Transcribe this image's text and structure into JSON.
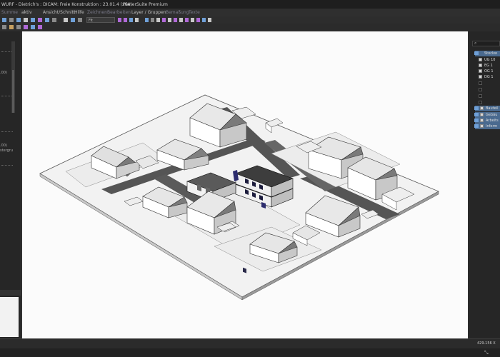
{
  "window": {
    "title": "WURF - Dietrich's : DICAM: Freie Konstruktion : 23.01.4 (x64)",
    "suite": "PlanerSuite Premium"
  },
  "menubar": {
    "items": [
      {
        "label": "Summe"
      },
      {
        "label": "aktiv"
      },
      {
        "label": "Ansicht/Schnitt"
      },
      {
        "label": "Hilfe"
      },
      {
        "label": "Zeichnen"
      },
      {
        "label": "Bearbeiten"
      },
      {
        "label": "Layer / Gruppen"
      },
      {
        "label": "Bemaßung"
      },
      {
        "label": "Texte"
      }
    ]
  },
  "toolbar": {
    "zoom_value": "Fit"
  },
  "leftpanel": {
    "labels": [
      ".00)",
      "",
      ".00)",
      "stergru"
    ]
  },
  "rightpanel": {
    "items": [
      {
        "label": "Stockw",
        "selected": true,
        "checked": false
      },
      {
        "label": "UG 10",
        "selected": false,
        "checked": true
      },
      {
        "label": "EG 1",
        "selected": false,
        "checked": true
      },
      {
        "label": "OG 1",
        "selected": false,
        "checked": true
      },
      {
        "label": "DG 1",
        "selected": false,
        "checked": true
      },
      {
        "label": "Bauteil",
        "selected": true,
        "checked": true
      },
      {
        "label": "Gebäu",
        "selected": true,
        "checked": true
      },
      {
        "label": "Arbeits",
        "selected": true,
        "checked": true
      },
      {
        "label": "Inform",
        "selected": true,
        "checked": true
      }
    ]
  },
  "statusbar": {
    "coord": "429.156 X"
  },
  "colors": {
    "selection": "#4a6a8f",
    "accent_blue": "#6fa0d8",
    "purple_icon": "#b06ad8"
  }
}
